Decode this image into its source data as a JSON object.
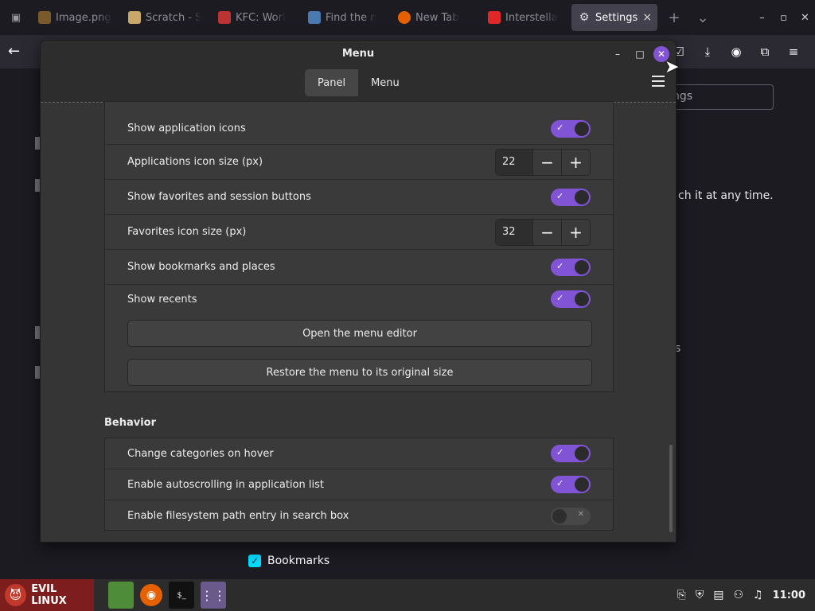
{
  "browser": {
    "tabs": [
      {
        "label": "Image.png",
        "color": "#7a5a2a",
        "active": false
      },
      {
        "label": "Scratch - S",
        "color": "#c9a86a",
        "active": false
      },
      {
        "label": "KFC: Worl",
        "color": "#b33",
        "active": false
      },
      {
        "label": "Find the n",
        "color": "#4a7ab0",
        "active": false
      },
      {
        "label": "New Tab",
        "color": "#e66000",
        "active": false
      },
      {
        "label": "Interstella",
        "color": "#e02828",
        "active": false
      },
      {
        "label": "Settings",
        "color": "#888",
        "active": true
      }
    ],
    "search_placeholder": "ngs",
    "bg_text": "ch it at any time.",
    "bg_fragment": "s",
    "bookmarks_label": "Bookmarks"
  },
  "dialog": {
    "title": "Menu",
    "tabs": {
      "panel": "Panel",
      "menu": "Menu"
    },
    "rows": [
      {
        "label": "Show application icons",
        "type": "switch",
        "on": true
      },
      {
        "label": "Applications icon size (px)",
        "type": "spin",
        "value": "22"
      },
      {
        "label": "Show favorites and session buttons",
        "type": "switch",
        "on": true
      },
      {
        "label": "Favorites icon size (px)",
        "type": "spin",
        "value": "32"
      },
      {
        "label": "Show bookmarks and places",
        "type": "switch",
        "on": true
      },
      {
        "label": "Show recents",
        "type": "switch",
        "on": true
      }
    ],
    "buttons": {
      "open_editor": "Open the menu editor",
      "restore_size": "Restore the menu to its original size"
    },
    "behavior": {
      "title": "Behavior",
      "rows": [
        {
          "label": "Change categories on hover",
          "on": true
        },
        {
          "label": "Enable autoscrolling in application list",
          "on": true
        },
        {
          "label": "Enable filesystem path entry in search box",
          "on": false
        }
      ]
    }
  },
  "taskbar": {
    "start_label": "EVIL LINUX",
    "clock": "11:00"
  },
  "accent": "#8154d6"
}
